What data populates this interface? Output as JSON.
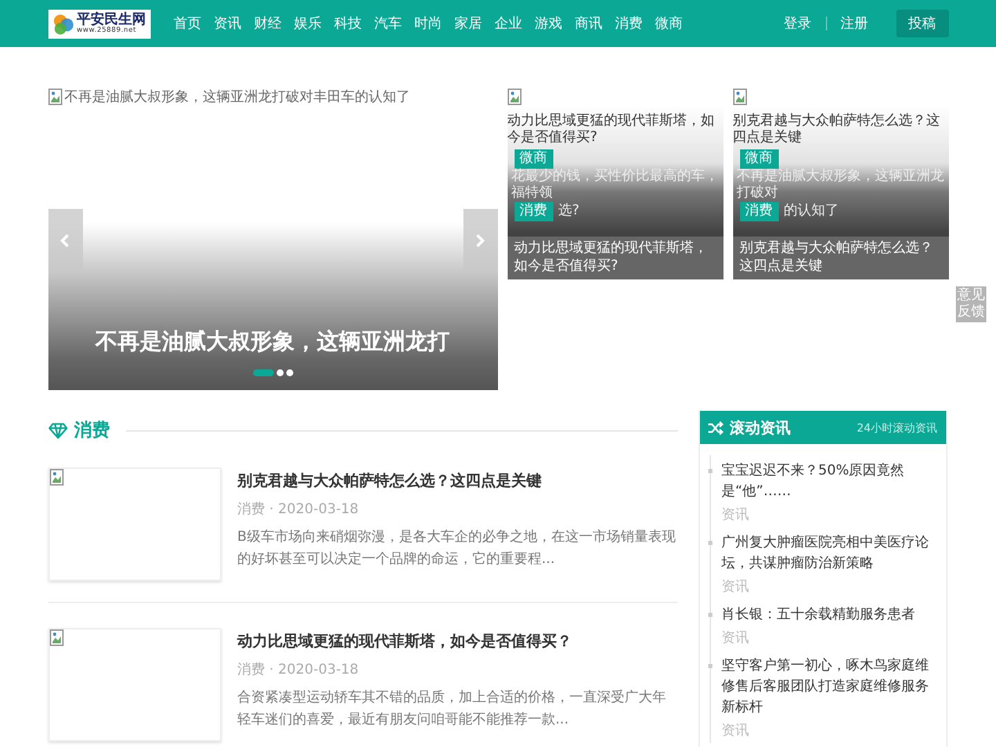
{
  "header": {
    "logo_title": "平安民生网",
    "logo_url": "www.25889.net",
    "nav": [
      {
        "label": "首页"
      },
      {
        "label": "资讯"
      },
      {
        "label": "财经"
      },
      {
        "label": "娱乐"
      },
      {
        "label": "科技"
      },
      {
        "label": "汽车"
      },
      {
        "label": "时尚"
      },
      {
        "label": "家居"
      },
      {
        "label": "企业"
      },
      {
        "label": "游戏"
      },
      {
        "label": "商讯"
      },
      {
        "label": "消费"
      },
      {
        "label": "微商"
      }
    ],
    "login": "登录",
    "register": "注册",
    "submit": "投稿"
  },
  "hero": {
    "alt_text": "不再是油腻大叔形象，这辆亚洲龙打破对丰田车的认知了",
    "caption": "不再是油腻大叔形象，这辆亚洲龙打",
    "dots": [
      {
        "selected": true
      },
      {
        "selected": false
      },
      {
        "selected": false
      }
    ]
  },
  "cards": [
    {
      "alt_text": "动力比思域更猛的现代菲斯塔，如今是否值得买?",
      "back_tag": "微商",
      "back_text": "花最少的钱，买性价比最高的车，福特领",
      "back_text_tail": "选?",
      "tag": "消费",
      "title": "动力比思域更猛的现代菲斯塔，如今是否值得买?"
    },
    {
      "alt_text": "别克君越与大众帕萨特怎么选？这四点是关键",
      "back_tag": "微商",
      "back_text": "不再是油腻大叔形象，这辆亚洲龙打破对",
      "back_text_tail": "的认知了",
      "tag": "消费",
      "title": "别克君越与大众帕萨特怎么选？这四点是关键"
    }
  ],
  "feedback": "意见反馈",
  "section": {
    "title": "消费"
  },
  "articles": [
    {
      "title": "别克君越与大众帕萨特怎么选？这四点是关键",
      "meta": "消费 · 2020-03-18",
      "summary": "B级车市场向来硝烟弥漫，是各大车企的必争之地，在这一市场销量表现的好坏甚至可以决定一个品牌的命运，它的重要程..."
    },
    {
      "title": "动力比思域更猛的现代菲斯塔，如今是否值得买？",
      "meta": "消费 · 2020-03-18",
      "summary": "合资紧凑型运动轿车其不错的品质，加上合适的价格，一直深受广大年轻车迷们的喜爱，最近有朋友问咱哥能不能推荐一款..."
    }
  ],
  "sidebar": {
    "title": "滚动资讯",
    "subtitle": "24小时滚动资讯",
    "items": [
      {
        "title": "宝宝迟迟不来？50%原因竟然是“他”……",
        "category": "资讯"
      },
      {
        "title": "广州复大肿瘤医院亮相中美医疗论坛，共谋肿瘤防治新策略",
        "category": "资讯"
      },
      {
        "title": "肖长银：五十余载精勤服务患者",
        "category": "资讯"
      },
      {
        "title": "坚守客户第一初心，啄木鸟家庭维修售后客服团队打造家庭维修服务新标杆",
        "category": "资讯"
      }
    ]
  }
}
